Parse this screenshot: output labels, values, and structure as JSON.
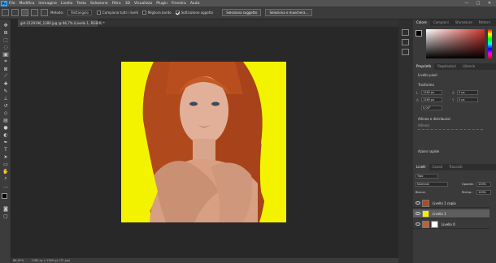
{
  "app": {
    "logo": "Ps"
  },
  "menu": [
    "File",
    "Modifica",
    "Immagine",
    "Livello",
    "Testo",
    "Selezione",
    "Filtro",
    "3D",
    "Visualizza",
    "Plugin",
    "Finestra",
    "Aiuto"
  ],
  "window_controls": {
    "minimize": "—",
    "maximize": "□",
    "close": "✕"
  },
  "options": {
    "metodo_label": "Metodo:",
    "metodo_value": "Rettangolo",
    "campiona_label": "Campiona tutti i livelli",
    "migliora_label": "Migliora bordo",
    "sottrazione_label": "Sottrazione oggetto",
    "seleziona_soggetto": "Seleziona soggetto",
    "seleziona_maschera": "Seleziona e maschera..."
  },
  "document_tab": "girl-2129196_1280.jpg @ 66,7% (Livello 1, RGB/8) *",
  "status": {
    "zoom": "66,67%",
    "info": "1280 px x 1280 px (72 ppi)"
  },
  "color_panel": {
    "tabs": [
      "Colore",
      "Campioni",
      "Sfumature",
      "Pattern"
    ],
    "foreground": "#000000",
    "background": "#ffffff",
    "spectrum_accent": "#d0342c"
  },
  "props_panel": {
    "tabs": [
      "Proprietà",
      "Regolazioni",
      "Librerie"
    ],
    "layer_type": "Livello pixel",
    "transform_label": "Trasforma",
    "width": "1280 px",
    "x": "0 px",
    "height": "1280 px",
    "y": "0 px",
    "angle": "0,00°",
    "align_label": "Allinea e distribuisci",
    "align_sub": "Allinea:",
    "quick_label": "Azioni rapide"
  },
  "layers_panel": {
    "tabs": [
      "Livelli",
      "Canali",
      "Tracciati"
    ],
    "filter_label": "Tipo",
    "blend_mode": "Normale",
    "opacity_label": "Opacità:",
    "opacity": "100%",
    "lock_label": "Blocca:",
    "fill_label": "Riemp.:",
    "fill": "100%",
    "layers": [
      {
        "name": "Livello 1 copia",
        "active": false
      },
      {
        "name": "Livello 1",
        "active": true
      },
      {
        "name": "Livello 0",
        "active": false
      }
    ]
  },
  "colors": {
    "canvas_bg": "#f3f300",
    "hair": "#b04a1c",
    "skin": "#d9a58a",
    "accent": "#31a8ff"
  },
  "icons": [
    "move-icon",
    "artboard-icon",
    "marquee-icon",
    "lasso-icon",
    "object-select-icon",
    "crop-icon",
    "frame-icon",
    "eyedropper-icon",
    "healing-brush-icon",
    "brush-icon",
    "clone-stamp-icon",
    "history-brush-icon",
    "eraser-icon",
    "gradient-icon",
    "blur-icon",
    "dodge-icon",
    "pen-icon",
    "type-icon",
    "path-select-icon",
    "rectangle-icon",
    "hand-icon",
    "zoom-icon",
    "more-tools-icon"
  ]
}
